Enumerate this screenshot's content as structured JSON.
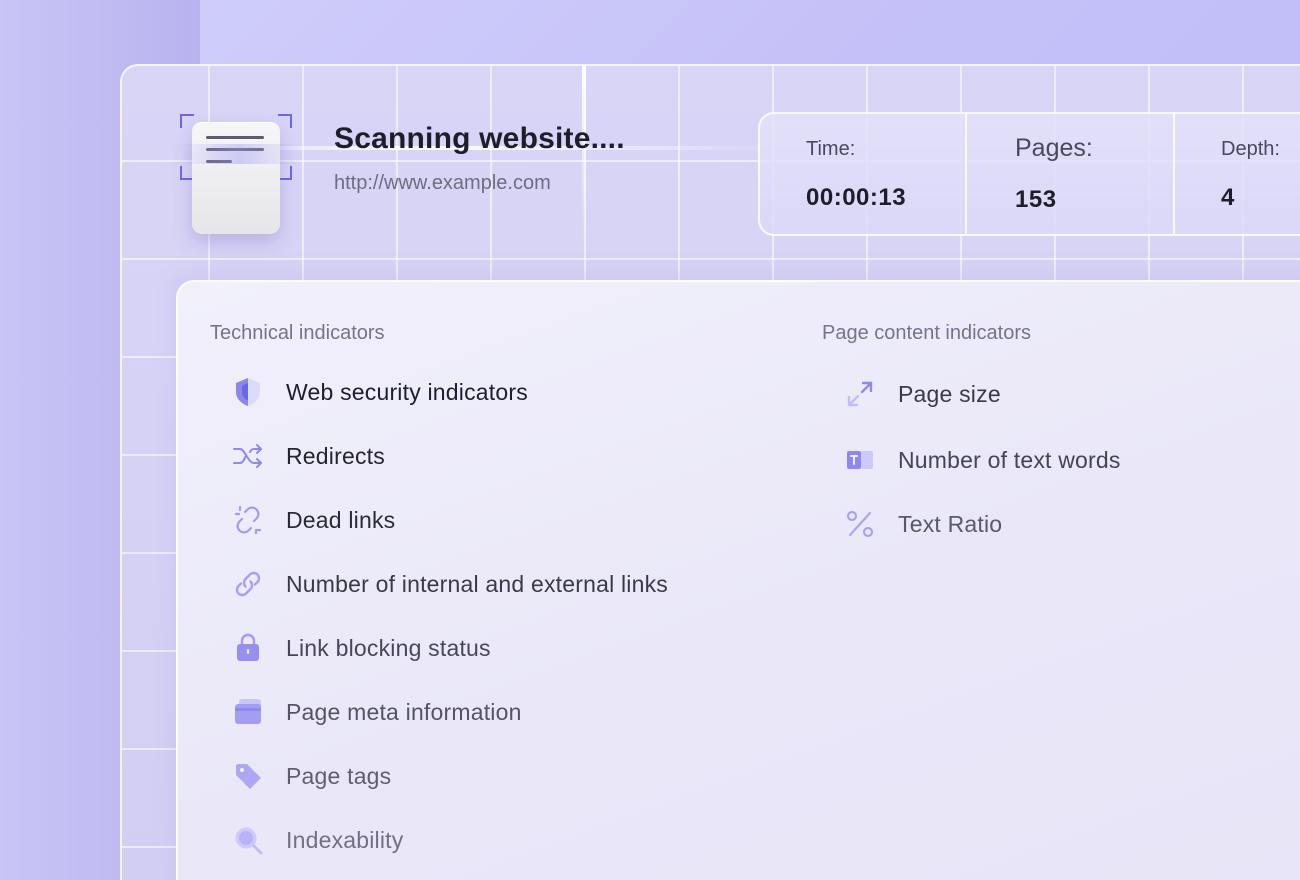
{
  "header": {
    "title": "Scanning website....",
    "url": "http://www.example.com"
  },
  "stats": [
    {
      "label": "Time:",
      "value": "00:00:13"
    },
    {
      "label": "Pages:",
      "value": "153"
    },
    {
      "label": "Depth:",
      "value": "4"
    }
  ],
  "technical": {
    "title": "Technical indicators",
    "items": [
      {
        "label": "Web security indicators",
        "icon": "shield-icon"
      },
      {
        "label": "Redirects",
        "icon": "shuffle-icon"
      },
      {
        "label": "Dead links",
        "icon": "broken-link-icon"
      },
      {
        "label": "Number of internal and external links",
        "icon": "link-icon"
      },
      {
        "label": "Link blocking status",
        "icon": "lock-icon"
      },
      {
        "label": "Page meta information",
        "icon": "cards-icon"
      },
      {
        "label": "Page tags",
        "icon": "tag-icon"
      },
      {
        "label": "Indexability",
        "icon": "search-icon"
      }
    ]
  },
  "content": {
    "title": "Page content indicators",
    "items": [
      {
        "label": "Page size",
        "icon": "expand-icon"
      },
      {
        "label": "Number of text words",
        "icon": "text-words-icon"
      },
      {
        "label": "Text Ratio",
        "icon": "percent-icon"
      }
    ]
  },
  "colors": {
    "accent": "#8a84ee",
    "background": "#c4c0f8",
    "text_dark": "#1e1d2b"
  }
}
